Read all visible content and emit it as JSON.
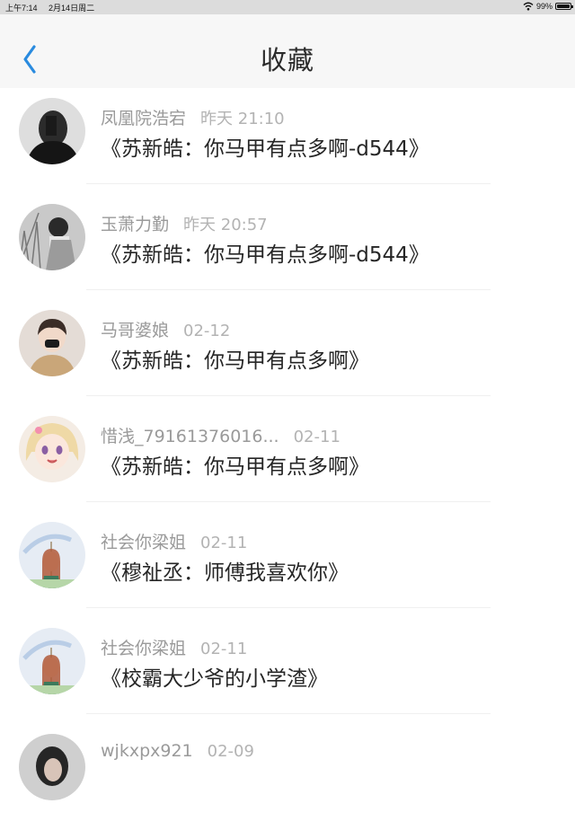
{
  "status_bar": {
    "time": "上午7:14",
    "date": "2月14日周二",
    "battery": "99%"
  },
  "nav": {
    "back_icon": "chevron-left-icon",
    "title": "收藏",
    "accent_color": "#2a8bdf"
  },
  "items": [
    {
      "user": "凤凰院浩宕",
      "time": "昨天 21:10",
      "title": "《苏新皓：你马甲有点多啊-d544》"
    },
    {
      "user": "玉萧力勤",
      "time": "昨天 20:57",
      "title": "《苏新皓：你马甲有点多啊-d544》"
    },
    {
      "user": "马哥婆娘",
      "time": "02-12",
      "title": "《苏新皓：你马甲有点多啊》"
    },
    {
      "user": "惜浅_79161376016...",
      "time": "02-11",
      "title": "《苏新皓：你马甲有点多啊》"
    },
    {
      "user": "社会你梁姐",
      "time": "02-11",
      "title": "《穆祉丞：师傅我喜欢你》"
    },
    {
      "user": "社会你梁姐",
      "time": "02-11",
      "title": "《校霸大少爷的小学渣》"
    },
    {
      "user": "wjkxpx921",
      "time": "02-09",
      "title": ""
    }
  ]
}
